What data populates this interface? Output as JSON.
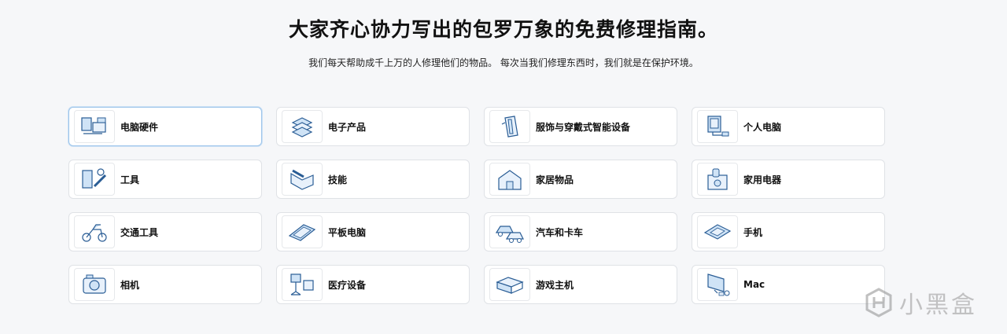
{
  "hero": {
    "title": "大家齐心协力写出的包罗万象的免费修理指南。",
    "subtitle": "我们每天帮助成千上万的人修理他们的物品。 每次当我们修理东西时，我们就是在保护环境。"
  },
  "categories": [
    {
      "label": "电脑硬件",
      "icon": "computer-hardware-icon"
    },
    {
      "label": "电子产品",
      "icon": "electronics-icon"
    },
    {
      "label": "服饰与穿戴式智能设备",
      "icon": "apparel-wearables-icon"
    },
    {
      "label": "个人电脑",
      "icon": "pc-icon"
    },
    {
      "label": "工具",
      "icon": "tools-icon"
    },
    {
      "label": "技能",
      "icon": "skills-icon"
    },
    {
      "label": "家居物品",
      "icon": "household-icon"
    },
    {
      "label": "家用电器",
      "icon": "appliance-icon"
    },
    {
      "label": "交通工具",
      "icon": "vehicle-icon"
    },
    {
      "label": "平板电脑",
      "icon": "tablet-icon"
    },
    {
      "label": "汽车和卡车",
      "icon": "car-truck-icon"
    },
    {
      "label": "手机",
      "icon": "phone-icon"
    },
    {
      "label": "相机",
      "icon": "camera-icon"
    },
    {
      "label": "医疗设备",
      "icon": "medical-device-icon"
    },
    {
      "label": "游戏主机",
      "icon": "game-console-icon"
    },
    {
      "label": "Mac",
      "icon": "mac-icon"
    }
  ],
  "watermark": {
    "text": "小黑盒"
  },
  "colors": {
    "accent": "#2f7fd6",
    "icon_fill": "#cfe3f6",
    "background": "#f6f7f9"
  }
}
